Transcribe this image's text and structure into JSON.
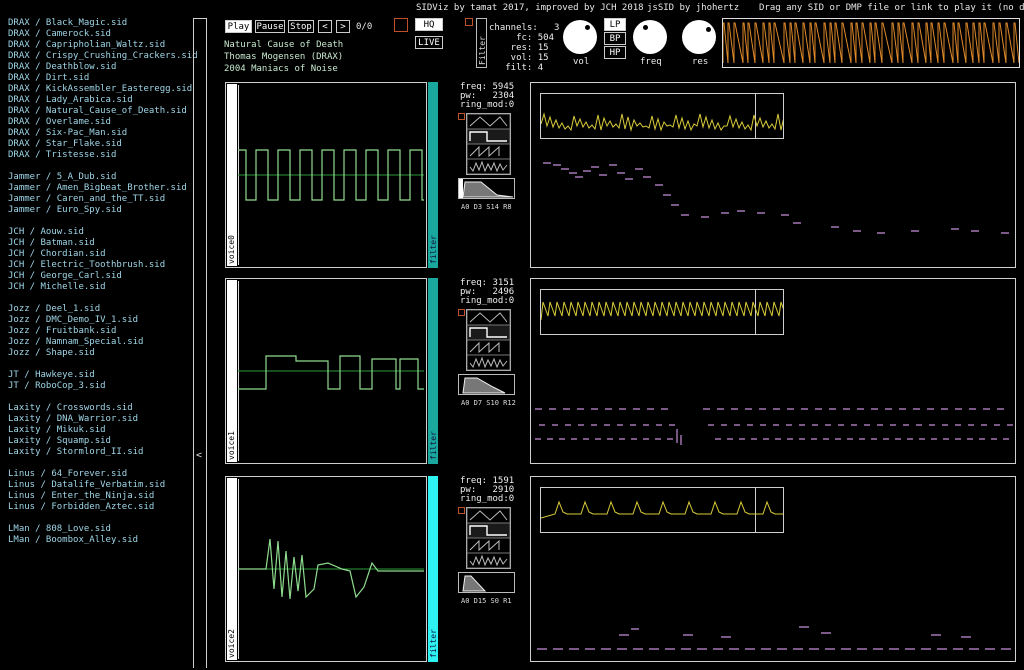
{
  "header": {
    "credits": "SIDViz by tamat 2017, improved by JCH 2018",
    "jssid": "jsSID by jhohertz",
    "drag_hint": "Drag any SID or DMP file or link to play it (no digi)",
    "play": "Play",
    "pause": "Pause",
    "stop": "Stop",
    "prev": "<",
    "next": ">",
    "track_counter": "0/0",
    "hq": "HQ",
    "live": "LIVE",
    "song_title": "Natural Cause of Death",
    "song_author": "Thomas Mogensen (DRAX)",
    "song_release": "2004 Maniacs of Noise"
  },
  "filter": {
    "label": "Filter",
    "lp": "LP",
    "bp": "BP",
    "hp": "HP",
    "stats": "channels:   3\n     fc: 504\n    res: 15\n    vol: 15\n   filt: 4",
    "knobs": [
      "vol",
      "freq",
      "res"
    ]
  },
  "sidebar": {
    "collapse": "<",
    "groups": [
      [
        "DRAX / Black_Magic.sid",
        "DRAX / Camerock.sid",
        "DRAX / Capripholian_Waltz.sid",
        "DRAX / Crispy_Crushing_Crackers.sid",
        "DRAX / Deathblow.sid",
        "DRAX / Dirt.sid",
        "DRAX / KickAssembler_Easteregg.sid",
        "DRAX / Lady_Arabica.sid",
        "DRAX / Natural_Cause_of_Death.sid",
        "DRAX / Overlame.sid",
        "DRAX / Six-Pac_Man.sid",
        "DRAX / Star_Flake.sid",
        "DRAX / Tristesse.sid"
      ],
      [
        "Jammer / 5_A_Dub.sid",
        "Jammer / Amen_Bigbeat_Brother.sid",
        "Jammer / Caren_and_the_TT.sid",
        "Jammer / Euro_Spy.sid"
      ],
      [
        "JCH / Aouw.sid",
        "JCH / Batman.sid",
        "JCH / Chordian.sid",
        "JCH / Electric_Toothbrush.sid",
        "JCH / George_Carl.sid",
        "JCH / Michelle.sid"
      ],
      [
        "Jozz / Deel_1.sid",
        "Jozz / DMC_Demo_IV_1.sid",
        "Jozz / Fruitbank.sid",
        "Jozz / Namnam_Special.sid",
        "Jozz / Shape.sid"
      ],
      [
        "JT / Hawkeye.sid",
        "JT / RoboCop_3.sid"
      ],
      [
        "Laxity / Crosswords.sid",
        "Laxity / DNA_Warrior.sid",
        "Laxity / Mikuk.sid",
        "Laxity / Squamp.sid",
        "Laxity / Stormlord_II.sid"
      ],
      [
        "Linus / 64_Forever.sid",
        "Linus / Datalife_Verbatim.sid",
        "Linus / Enter_the_Ninja.sid",
        "Linus / Forbidden_Aztec.sid"
      ],
      [
        "LMan / 808_Love.sid",
        "LMan / Boombox_Alley.sid"
      ]
    ]
  },
  "voices": [
    {
      "label": "voice0",
      "filter_label": "filter",
      "filter_color": "#1aa89e",
      "stats": "freq: 5945\npw:   2304\nring_mod:0",
      "adsr": "A0  D3  S14 R8"
    },
    {
      "label": "voice1",
      "filter_label": "filter",
      "filter_color": "#1aa89e",
      "stats": "freq: 3151\npw:   2496\nring_mod:0",
      "adsr": "A0  D7  S10 R12"
    },
    {
      "label": "voice2",
      "filter_label": "filter",
      "filter_color": "#2ef2f2",
      "stats": "freq: 1591\npw:   2910\nring_mod:0",
      "adsr": "A0  D15 S0  R1"
    }
  ],
  "colors": {
    "wave": "#8fdc8f",
    "envelope": "#d9cc3a",
    "notes": "#c78fd8",
    "master": "#e08a2c",
    "link": "#9fd6e8"
  }
}
